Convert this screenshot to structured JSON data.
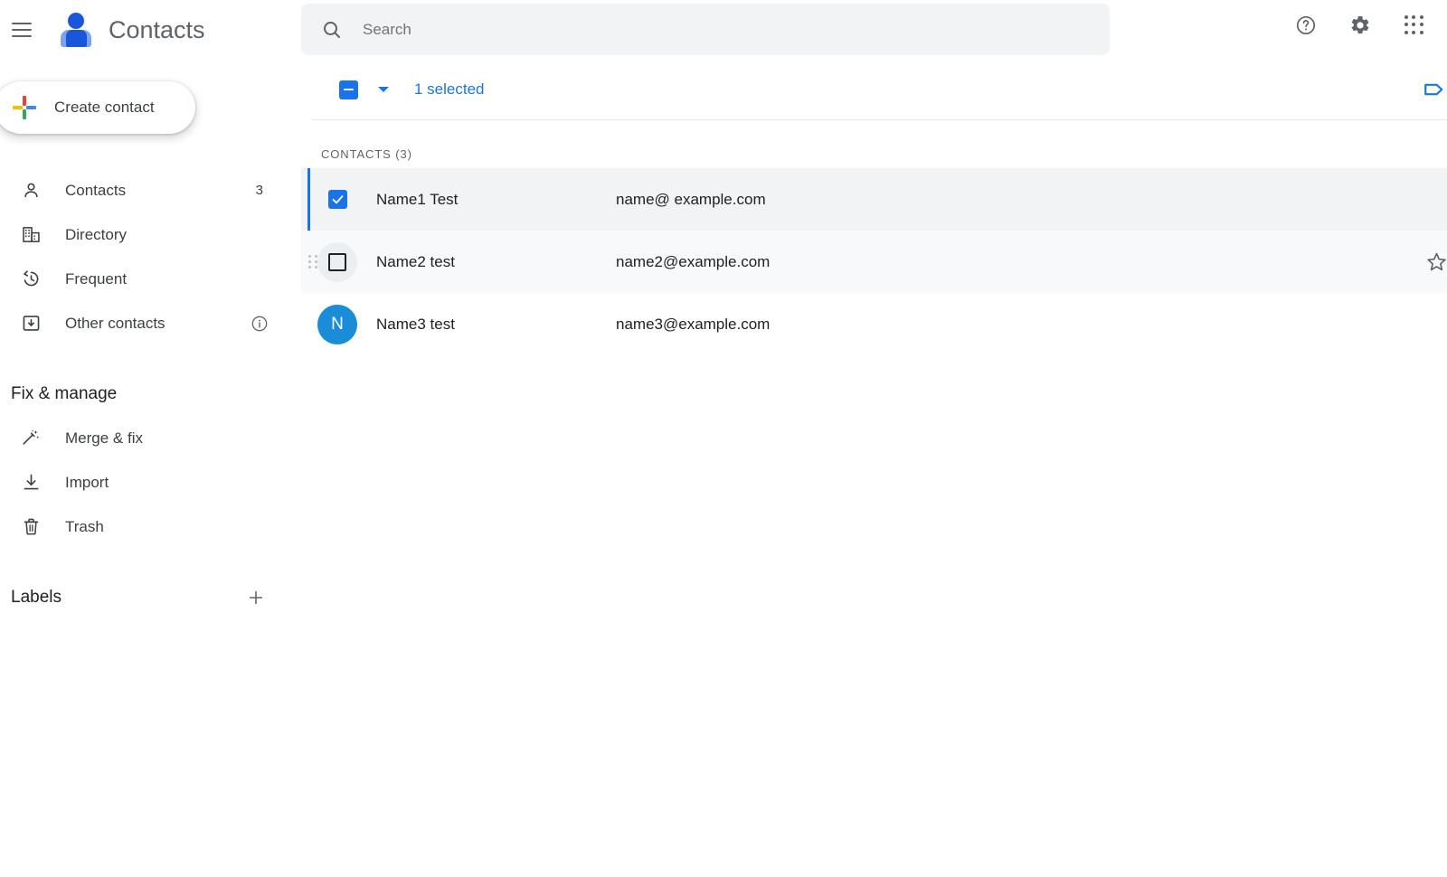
{
  "app": {
    "title": "Contacts",
    "menu_icon": "hamburger-menu-icon",
    "logo_icon": "contacts-person-logo"
  },
  "search": {
    "placeholder": "Search",
    "value": "",
    "icon": "search-icon"
  },
  "top_actions": [
    {
      "name": "help-icon",
      "label": "Help"
    },
    {
      "name": "gear-icon",
      "label": "Settings"
    },
    {
      "name": "apps-grid-icon",
      "label": "Google apps"
    }
  ],
  "sidebar": {
    "create_button": {
      "label": "Create contact",
      "icon": "multicolor-plus-icon"
    },
    "items": [
      {
        "label": "Contacts",
        "icon": "person-icon",
        "count": "3",
        "active": true
      },
      {
        "label": "Directory",
        "icon": "building-icon",
        "count": "",
        "active": false
      },
      {
        "label": "Frequent",
        "icon": "history-icon",
        "count": "",
        "active": false
      },
      {
        "label": "Other contacts",
        "icon": "archive-icon",
        "count": "",
        "info": "info-circle-icon",
        "active": false
      }
    ],
    "fix_manage": {
      "title": "Fix & manage",
      "items": [
        {
          "label": "Merge & fix",
          "icon": "magic-wand-icon"
        },
        {
          "label": "Import",
          "icon": "download-icon"
        },
        {
          "label": "Trash",
          "icon": "trash-icon"
        }
      ]
    },
    "labels": {
      "title": "Labels",
      "add_icon": "plus-icon"
    }
  },
  "selection_bar": {
    "checkbox_state": "indeterminate",
    "checkbox_icon": "indeterminate-checkbox-icon",
    "dropdown_icon": "chevron-down-icon",
    "selected_text": "1 selected",
    "label_icon": "tag-label-icon",
    "accent_color": "#1a73e8"
  },
  "list": {
    "header": "CONTACTS (3)",
    "columns": [
      "name",
      "email"
    ],
    "rows": [
      {
        "name": "Name1 Test",
        "email": "name@ example.com",
        "lead": "checkbox",
        "checked": true,
        "state": "selected",
        "avatar_letter": "",
        "avatar_color": ""
      },
      {
        "name": "Name2 test",
        "email": "name2@example.com",
        "lead": "checkbox",
        "checked": false,
        "state": "hovered",
        "avatar_letter": "",
        "avatar_color": "",
        "star_icon": "star-outline-icon"
      },
      {
        "name": "Name3 test",
        "email": "name3@example.com",
        "lead": "avatar",
        "checked": false,
        "state": "default",
        "avatar_letter": "N",
        "avatar_color": "#1a8cd8"
      }
    ]
  }
}
